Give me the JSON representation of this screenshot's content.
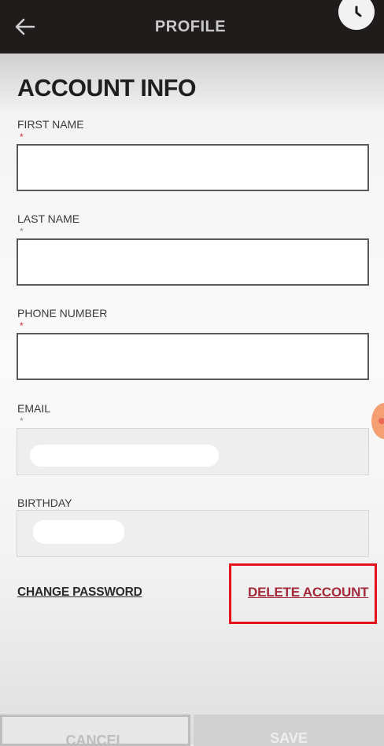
{
  "header": {
    "title": "PROFILE",
    "back_icon": "arrow-left-icon",
    "clock_icon": "clock-icon"
  },
  "page_title": "ACCOUNT INFO",
  "required_marker": "*",
  "fields": [
    {
      "label": "FIRST NAME",
      "value": "",
      "required_color": "#c62a3a"
    },
    {
      "label": "LAST NAME",
      "value": "",
      "required_color": "#8a8a8a"
    },
    {
      "label": "PHONE NUMBER",
      "value": "",
      "required_color": "#c62a3a"
    },
    {
      "label": "EMAIL",
      "value": "",
      "disabled": true,
      "required_color": "#8a8a8a"
    },
    {
      "label": "BIRTHDAY",
      "value": "",
      "disabled": true
    }
  ],
  "links": {
    "change_password": "CHANGE PASSWORD",
    "delete_account": "DELETE ACCOUNT"
  },
  "footer": {
    "cancel": "CANCEL",
    "save": "SAVE"
  },
  "colors": {
    "header_bg": "#1f1c1b",
    "delete_link": "#a3283a",
    "highlight_box": "#e8121a"
  }
}
